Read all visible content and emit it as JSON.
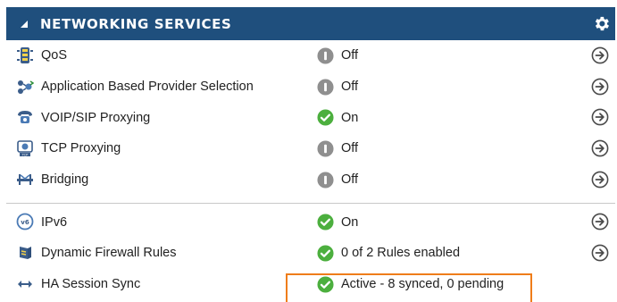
{
  "panel": {
    "title": "NETWORKING SERVICES"
  },
  "rows": [
    {
      "label": "QoS",
      "status": "Off",
      "state": "off",
      "icon": "qos-icon"
    },
    {
      "label": "Application Based Provider Selection",
      "status": "Off",
      "state": "off",
      "icon": "provider-selection-icon"
    },
    {
      "label": "VOIP/SIP Proxying",
      "status": "On",
      "state": "on",
      "icon": "phone-icon"
    },
    {
      "label": "TCP Proxying",
      "status": "Off",
      "state": "off",
      "icon": "tcp-icon"
    },
    {
      "label": "Bridging",
      "status": "Off",
      "state": "off",
      "icon": "bridge-icon"
    }
  ],
  "rows2": [
    {
      "label": "IPv6",
      "status": "On",
      "state": "on",
      "icon": "ipv6-icon"
    },
    {
      "label": "Dynamic Firewall Rules",
      "status": "0 of 2 Rules enabled",
      "state": "on",
      "icon": "firewall-icon"
    },
    {
      "label": "HA Session Sync",
      "status": "Active - 8 synced, 0 pending",
      "state": "on",
      "icon": "sync-arrows-icon"
    }
  ],
  "colors": {
    "header_bg": "#1f4f7d",
    "on_green": "#4caf3e",
    "off_gray": "#8f8f8f",
    "highlight": "#ef7d1a"
  }
}
